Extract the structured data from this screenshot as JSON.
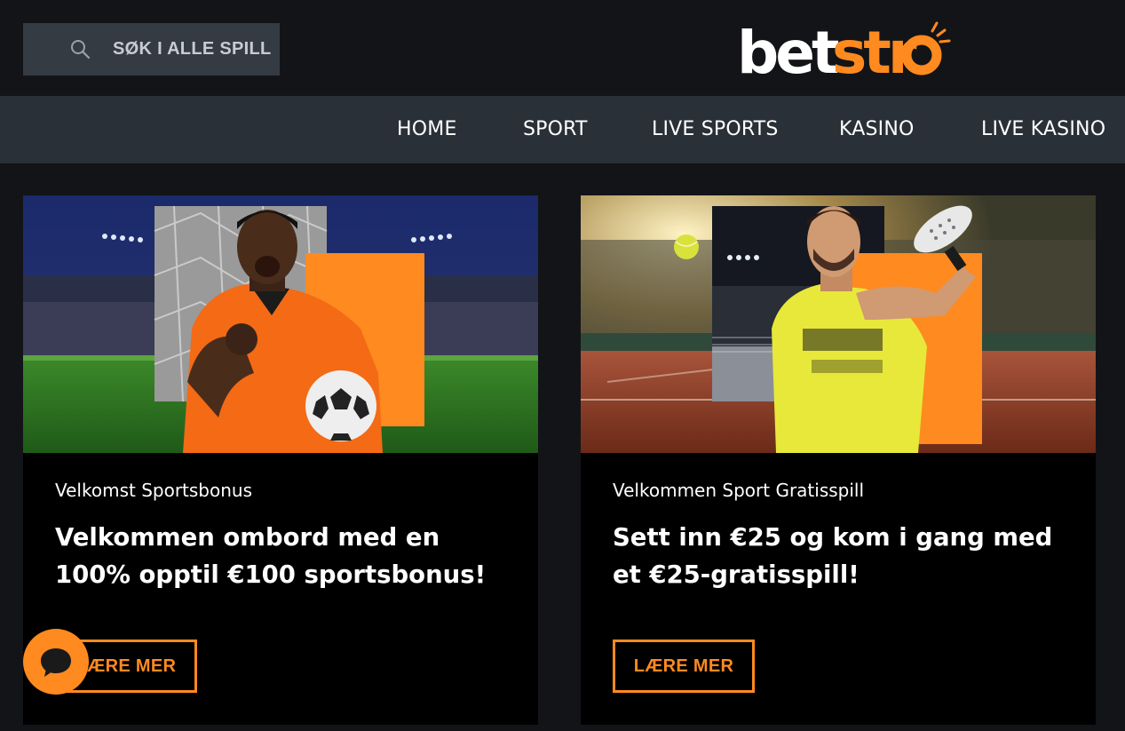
{
  "header": {
    "search_placeholder": "SØK I ALLE SPILL",
    "logo_text": "betstro",
    "brand_colors": {
      "white": "#ffffff",
      "orange": "#ff8a1f"
    }
  },
  "nav": {
    "items": [
      {
        "label": "HOME"
      },
      {
        "label": "SPORT"
      },
      {
        "label": "LIVE SPORTS"
      },
      {
        "label": "KASINO"
      },
      {
        "label": "LIVE KASINO"
      }
    ]
  },
  "promos": [
    {
      "subtitle": "Velkomst Sportsbonus",
      "headline": "Velkommen ombord med en 100% opptil €100 sportsbonus!",
      "button": "LÆRE MER",
      "image_icon": "football-player-image"
    },
    {
      "subtitle": "Velkommen Sport Gratisspill",
      "headline": "Sett inn €25 og kom i gang med et €25-gratisspill!",
      "button": "LÆRE MER",
      "image_icon": "tennis-player-image"
    }
  ],
  "chat": {
    "icon": "chat-bubble-icon"
  },
  "colors": {
    "page_bg": "#131418",
    "nav_bg": "#2a3038",
    "search_bg": "#353b43",
    "card_bg": "#000000",
    "accent": "#ff8a1f"
  }
}
